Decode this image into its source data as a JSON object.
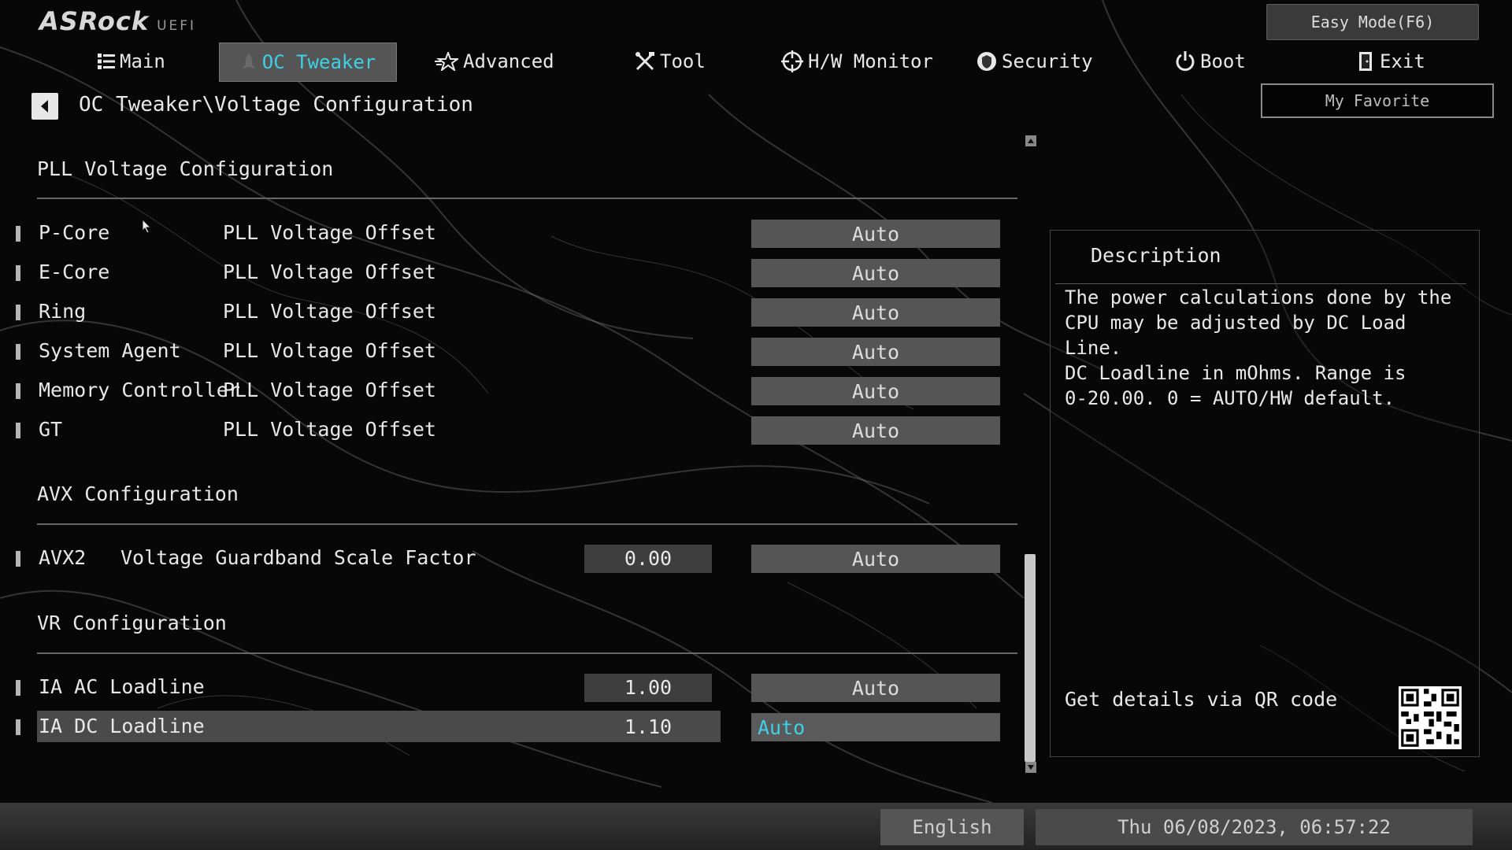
{
  "header": {
    "brand": "ASRock",
    "brand_sub": "UEFI",
    "easy_mode": "Easy Mode(F6)",
    "my_favorite": "My Favorite"
  },
  "tabs": [
    {
      "label": "Main",
      "icon": "list-icon"
    },
    {
      "label": "OC Tweaker",
      "icon": "rocket-icon",
      "active": true
    },
    {
      "label": "Advanced",
      "icon": "star-icon"
    },
    {
      "label": "Tool",
      "icon": "tools-icon"
    },
    {
      "label": "H/W Monitor",
      "icon": "crosshair-icon"
    },
    {
      "label": "Security",
      "icon": "shield-icon"
    },
    {
      "label": "Boot",
      "icon": "power-icon"
    },
    {
      "label": "Exit",
      "icon": "exit-door-icon"
    }
  ],
  "breadcrumb": "OC Tweaker\\Voltage Configuration",
  "sections": {
    "pll": "PLL Voltage Configuration",
    "avx": "AVX Configuration",
    "vr": "VR Configuration"
  },
  "pll_rows": [
    {
      "name": "P-Core",
      "item": "PLL Voltage Offset",
      "value": "Auto"
    },
    {
      "name": "E-Core",
      "item": "PLL Voltage Offset",
      "value": "Auto"
    },
    {
      "name": "Ring",
      "item": "PLL Voltage Offset",
      "value": "Auto"
    },
    {
      "name": "System Agent",
      "item": "PLL Voltage Offset",
      "value": "Auto"
    },
    {
      "name": "Memory Controller",
      "item": "PLL Voltage Offset",
      "value": "Auto"
    },
    {
      "name": "GT",
      "item": "PLL Voltage Offset",
      "value": "Auto"
    }
  ],
  "avx_row": {
    "name": "AVX2",
    "item": "Voltage Guardband Scale Factor",
    "current": "0.00",
    "value": "Auto"
  },
  "vr_rows": [
    {
      "name": "IA AC Loadline",
      "current": "1.00",
      "value": "Auto"
    },
    {
      "name": "IA DC Loadline",
      "current": "1.10",
      "value": "Auto",
      "selected": true
    }
  ],
  "description": {
    "title": "Description",
    "lines": [
      "The power calculations done by the",
      "CPU may be adjusted by DC Load Line.",
      "DC Loadline in mOhms. Range is",
      "0-20.00. 0 = AUTO/HW default."
    ],
    "qr_label": "Get details via QR code"
  },
  "footer": {
    "language": "English",
    "datetime": "Thu 06/08/2023, 06:57:22"
  },
  "colors": {
    "accent": "#3fd0e6",
    "background": "#050505",
    "field": "#555555"
  }
}
